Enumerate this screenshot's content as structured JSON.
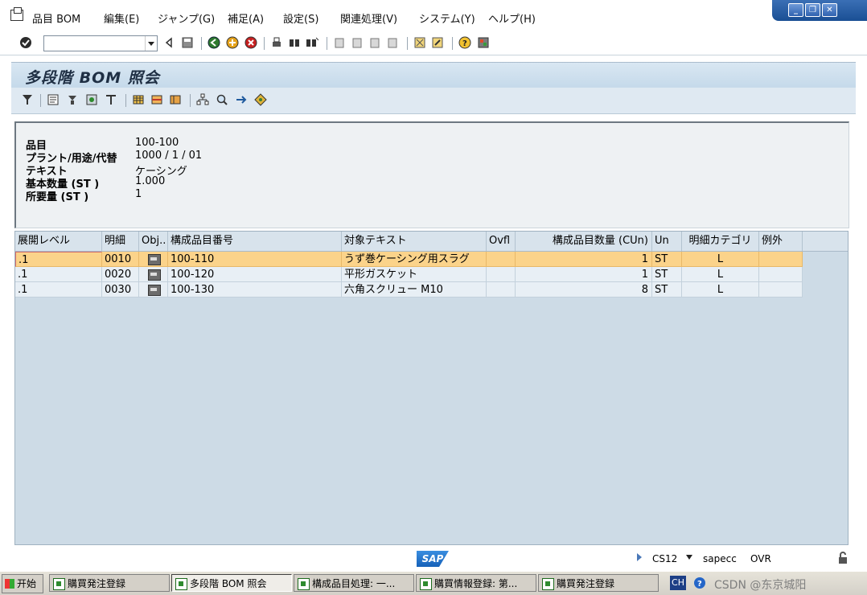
{
  "menu": [
    "品目 BOM",
    "編集(E)",
    "ジャンプ(G)",
    "補足(A)",
    "設定(S)",
    "関連処理(V)",
    "システム(Y)",
    "ヘルプ(H)"
  ],
  "window_controls": [
    "_",
    "❐",
    "✕"
  ],
  "toolbar": {
    "command_field_value": ""
  },
  "page": {
    "title": "多段階 BOM 照会"
  },
  "header": {
    "fields": [
      {
        "label": "品目",
        "value": "100-100"
      },
      {
        "label": "プラント/用途/代替",
        "value": "1000 / 1 / 01"
      },
      {
        "label": "テキスト",
        "value": "ケーシング"
      },
      {
        "label": "基本数量 (ST )",
        "value": "1.000"
      },
      {
        "label": "所要量 (ST )",
        "value": "1"
      }
    ]
  },
  "grid": {
    "columns": [
      "展開レベル",
      "明細",
      "Obj..",
      "構成品目番号",
      "対象テキスト",
      "Ovfl",
      "構成品目数量 (CUn)",
      "Un",
      "明細カテゴリ",
      "例外"
    ],
    "rows": [
      {
        "level": ".1",
        "item": "0010",
        "component": "100-110",
        "text": "うず巻ケーシング用スラグ",
        "ovfl": "",
        "qty": "1",
        "unit": "ST",
        "category": "L",
        "exception": "",
        "selected": true
      },
      {
        "level": ".1",
        "item": "0020",
        "component": "100-120",
        "text": "平形ガスケット",
        "ovfl": "",
        "qty": "1",
        "unit": "ST",
        "category": "L",
        "exception": "",
        "selected": false
      },
      {
        "level": ".1",
        "item": "0030",
        "component": "100-130",
        "text": "六角スクリュー M10",
        "ovfl": "",
        "qty": "8",
        "unit": "ST",
        "category": "L",
        "exception": "",
        "selected": false
      }
    ]
  },
  "status": {
    "transaction": "CS12",
    "server": "sapecc",
    "mode": "OVR",
    "logo": "SAP"
  },
  "taskbar": {
    "start": "开始",
    "tasks": [
      "購買発注登録",
      "多段階 BOM 照会",
      "構成品目処理: 一...",
      "購買情報登録: 第...",
      "購買発注登録"
    ],
    "lang": "CH",
    "watermark": "CSDN @东京城阳"
  }
}
